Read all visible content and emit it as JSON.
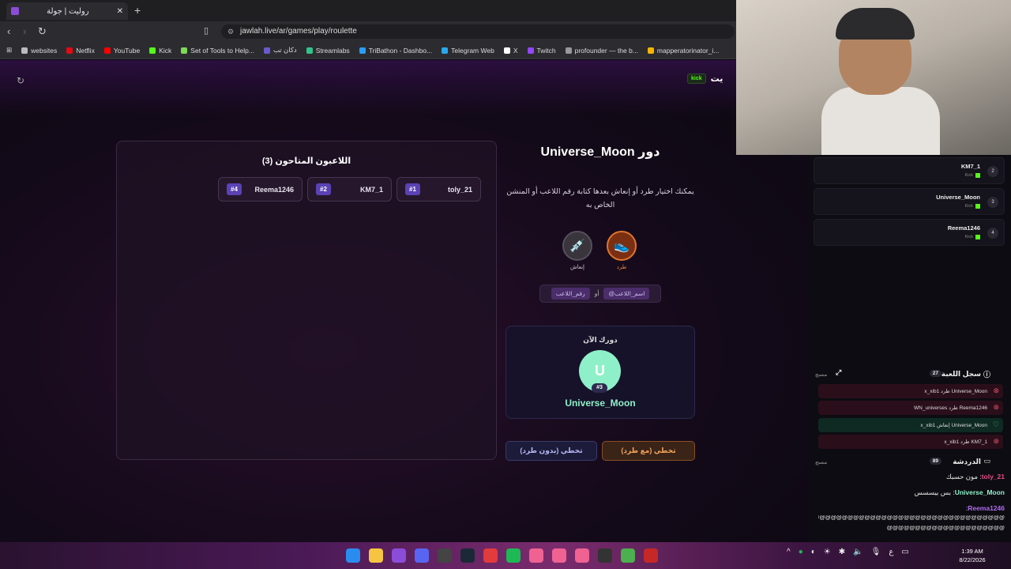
{
  "browser": {
    "tab_title": "روليت | جولة",
    "tab_close": "✕",
    "new_tab": "+",
    "url": "jawlah.live/ar/games/play/roulette",
    "bookmarks": [
      "websites",
      "Netflix",
      "YouTube",
      "Kick",
      "Set of Tools to Help...",
      "دكان تب",
      "Streamlabs",
      "TriBathon - Dashbo...",
      "Telegram Web",
      "X",
      "Twitch",
      "profounder — the b...",
      "mapperatorinator_i..."
    ]
  },
  "header": {
    "brand": "يت",
    "kick_label": "kick"
  },
  "players": {
    "title": "اللاعبون المتاحون (3)",
    "cards": [
      {
        "num": "#1",
        "name": "toly_21"
      },
      {
        "num": "#2",
        "name": "KM7_1"
      },
      {
        "num": "#4",
        "name": "Reema1246"
      }
    ]
  },
  "turn": {
    "title": "دور Universe_Moon",
    "instructions": "يمكنك اختيار طرد أو إنعاش بعدها كتابة رقم اللاعب أو المنشن الخاص به",
    "kick_label": "طرد",
    "revive_label": "إنعاش",
    "hint_or": "أو",
    "hint_number": "رقم_اللاعب",
    "hint_mention": "@اسم_اللاعب"
  },
  "now": {
    "label": "دورك الآن",
    "avatar_letter": "U",
    "badge": "#3",
    "name": "Universe_Moon"
  },
  "buttons": {
    "skip_with_kick": "تخطي (مع طرد)",
    "skip_without_kick": "تخطي (بدون طرد)"
  },
  "queue": [
    {
      "name": "KM7_1",
      "platform": "Kick",
      "num": "2"
    },
    {
      "name": "Universe_Moon",
      "platform": "Kick",
      "num": "3"
    },
    {
      "name": "Reema1246",
      "platform": "Kick",
      "num": "4"
    }
  ],
  "game_log": {
    "title": "سجل اللعبة",
    "count": "27",
    "clear": "مسح",
    "rows": [
      {
        "text": "x_xib1 طرد Universe_Moon",
        "type": "kick"
      },
      {
        "text": "WN_universes طرد Reema1246",
        "type": "kick"
      },
      {
        "text": "x_xib1 إنعاش Universe_Moon",
        "type": "revive"
      },
      {
        "text": "x_xib1 طرد KM7_1",
        "type": "kick"
      }
    ]
  },
  "chat": {
    "title": "الدردشة",
    "count": "89",
    "clear": "مسح",
    "messages": [
      {
        "user": "toly_21",
        "color": "#e84a8a",
        "text": "مون حسبك"
      },
      {
        "user": "Universe_Moon",
        "color": "#8ef0c8",
        "text": "بس بيسسس"
      },
      {
        "user": "Reema1246",
        "color": "#b06cf0",
        "text": ""
      }
    ],
    "spam_line_1": "@@@@@@@@@@@@@@@@@@@@@@@@@@@@@@@@@@@",
    "spam_line_2": "@@@@@@@@@@@@@@@@@@@@@"
  },
  "taskbar": {
    "time": "1:39 AM",
    "date": "8/22/2026",
    "lang": "ع"
  },
  "colors": {
    "accent_green": "#8ef0c8",
    "kick_orange": "#e0742c",
    "badge_purple": "#5a42b5"
  }
}
